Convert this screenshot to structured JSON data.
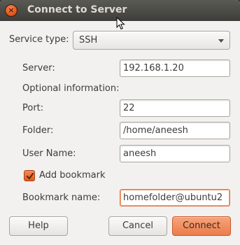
{
  "window": {
    "title": "Connect to Server"
  },
  "service": {
    "label": "Service type:",
    "value": "SSH"
  },
  "server": {
    "label": "Server:",
    "value": "192.168.1.20"
  },
  "optional": {
    "heading": "Optional information:",
    "port_label": "Port:",
    "port_value": "22",
    "folder_label": "Folder:",
    "folder_value": "/home/aneesh",
    "username_label": "User Name:",
    "username_value": "aneesh"
  },
  "bookmark": {
    "checkbox_label": "Add bookmark",
    "checked": true,
    "name_label": "Bookmark name:",
    "name_value": "homefolder@ubuntu2"
  },
  "buttons": {
    "help": "Help",
    "cancel": "Cancel",
    "connect": "Connect"
  },
  "icons": {
    "close": "close-icon",
    "dropdown": "chevron-down-icon",
    "check": "checkmark-icon",
    "cursor": "mouse-cursor-icon"
  },
  "colors": {
    "accent": "#ec7c4a",
    "titlebar": "#3e3d39",
    "window_bg": "#f2f1f0"
  }
}
